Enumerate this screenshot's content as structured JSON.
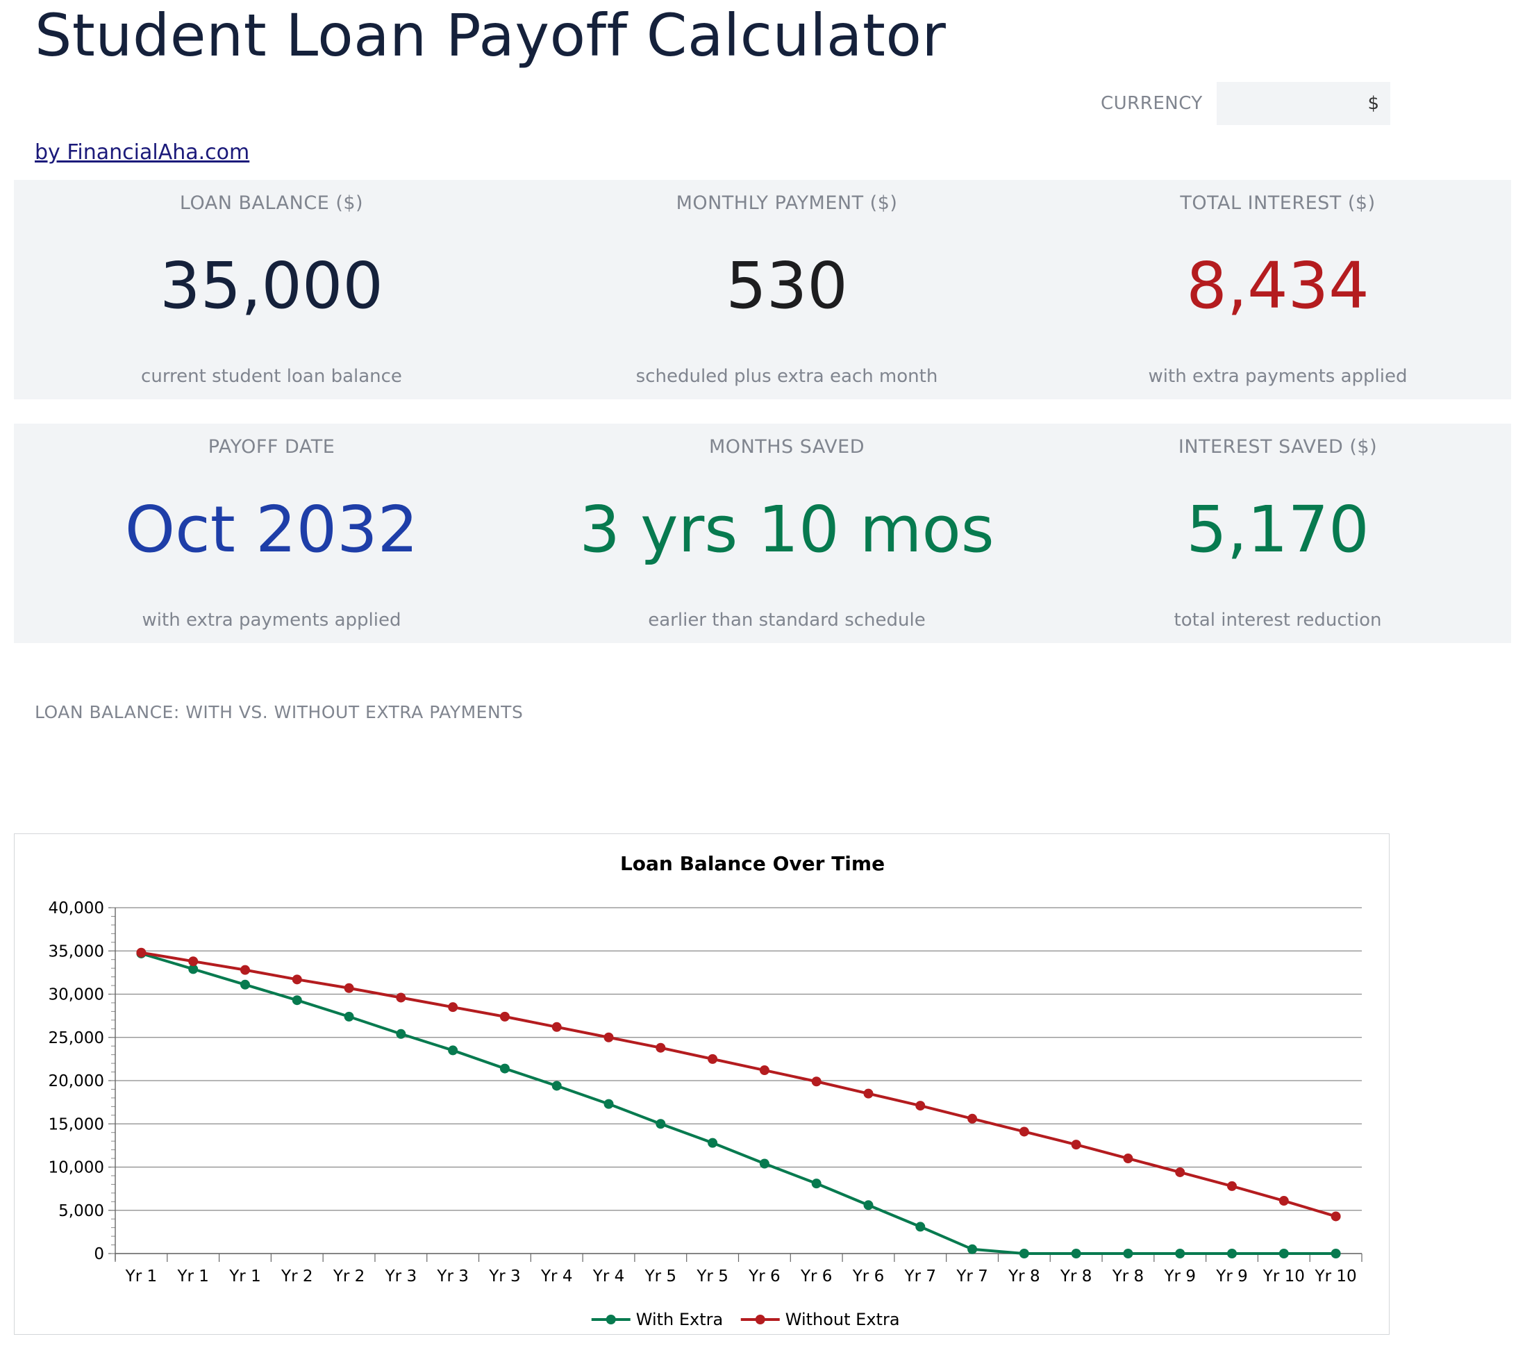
{
  "title": "Student Loan Payoff Calculator",
  "currency": {
    "label": "CURRENCY",
    "value": "$"
  },
  "byline": "by FinancialAha.com",
  "kpis_row1": [
    {
      "label": "LOAN BALANCE ($)",
      "value": "35,000",
      "note": "current student loan balance",
      "color": "#15213b"
    },
    {
      "label": "MONTHLY PAYMENT ($)",
      "value": "530",
      "note": "scheduled plus extra each month",
      "color": "#1d1d1f"
    },
    {
      "label": "TOTAL INTEREST ($)",
      "value": "8,434",
      "note": "with extra payments applied",
      "color": "#b41c1f"
    }
  ],
  "kpis_row2": [
    {
      "label": "PAYOFF DATE",
      "value": "Oct 2032",
      "note": "with extra payments applied",
      "color": "#1e3ea8"
    },
    {
      "label": "MONTHS SAVED",
      "value": "3 yrs 10 mos",
      "note": "earlier than standard schedule",
      "color": "#077a4f"
    },
    {
      "label": "INTEREST SAVED ($)",
      "value": "5,170",
      "note": "total interest reduction",
      "color": "#077a4f"
    }
  ],
  "chart_section_title": "LOAN BALANCE: WITH VS. WITHOUT EXTRA PAYMENTS",
  "chart_data": {
    "type": "line",
    "title": "Loan Balance Over Time",
    "xlabel": "",
    "ylabel": "",
    "categories": [
      "Yr 1",
      "Yr 1",
      "Yr 1",
      "Yr 2",
      "Yr 2",
      "Yr 3",
      "Yr 3",
      "Yr 3",
      "Yr 4",
      "Yr 4",
      "Yr 5",
      "Yr 5",
      "Yr 6",
      "Yr 6",
      "Yr 6",
      "Yr 7",
      "Yr 7",
      "Yr 8",
      "Yr 8",
      "Yr 8",
      "Yr 9",
      "Yr 9",
      "Yr 10",
      "Yr 10"
    ],
    "series": [
      {
        "name": "With Extra",
        "color": "#077a4f",
        "values": [
          34700,
          32900,
          31100,
          29300,
          27400,
          25400,
          23500,
          21400,
          19400,
          17300,
          15000,
          12800,
          10400,
          8100,
          5600,
          3100,
          500,
          0,
          0,
          0,
          0,
          0,
          0,
          0
        ]
      },
      {
        "name": "Without Extra",
        "color": "#b41c1f",
        "values": [
          34800,
          33800,
          32800,
          31700,
          30700,
          29600,
          28500,
          27400,
          26200,
          25000,
          23800,
          22500,
          21200,
          19900,
          18500,
          17100,
          15600,
          14100,
          12600,
          11000,
          9400,
          7800,
          6100,
          4300
        ]
      }
    ],
    "ylim": [
      0,
      40000
    ],
    "yticks": [
      "0",
      "5,000",
      "10,000",
      "15,000",
      "20,000",
      "25,000",
      "30,000",
      "35,000",
      "40,000"
    ],
    "grid": true,
    "legend": "bottom"
  }
}
